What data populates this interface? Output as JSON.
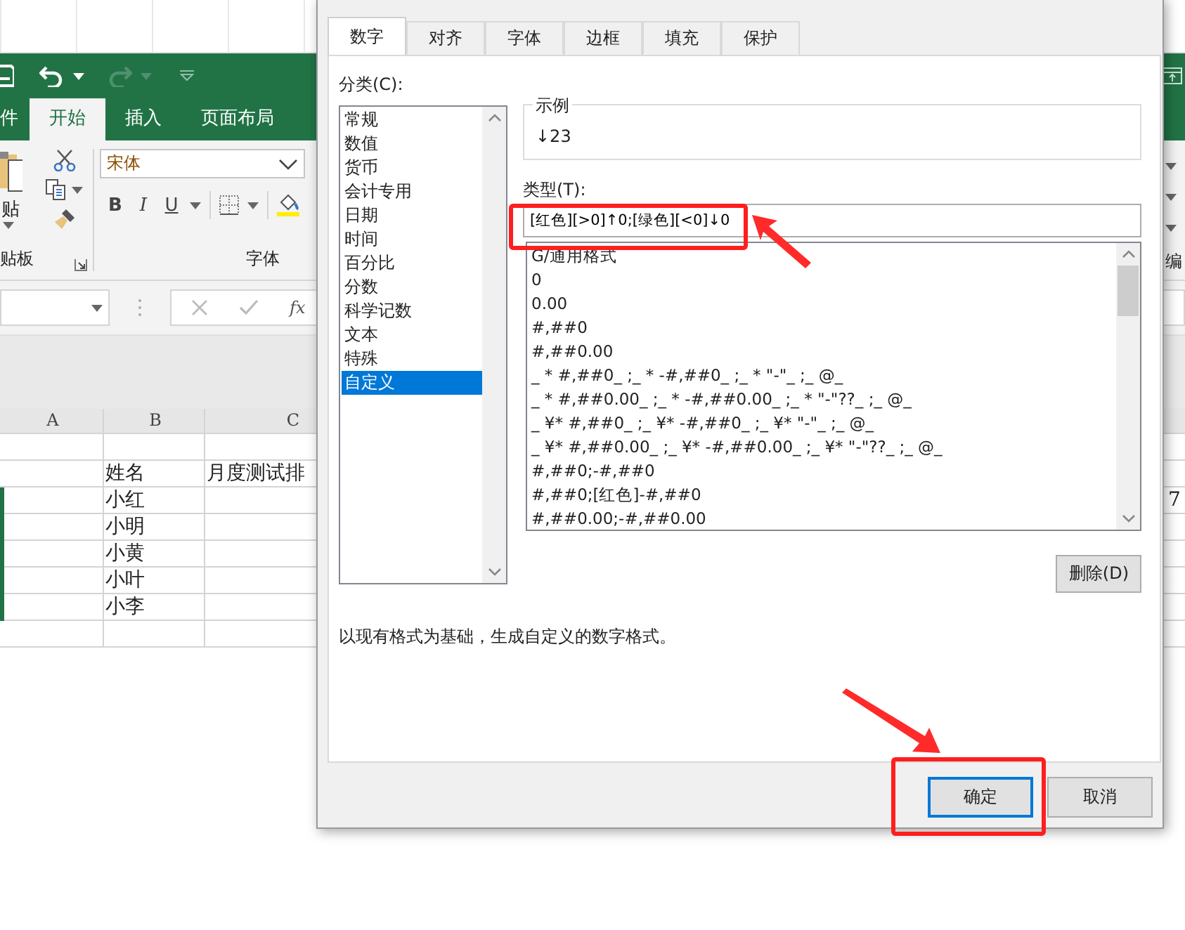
{
  "excel": {
    "ribbon_tabs": [
      {
        "label": "件",
        "selected": false
      },
      {
        "label": "开始",
        "selected": true
      },
      {
        "label": "插入",
        "selected": false
      },
      {
        "label": "页面布局",
        "selected": false
      }
    ],
    "clipboard": {
      "paste_label": "贴",
      "group_label": "贴板"
    },
    "font": {
      "name": "宋体",
      "group_label": "字体",
      "bold": "B",
      "italic": "I",
      "underline": "U"
    },
    "formula_bar": {
      "function_label": "fx"
    },
    "right_group_label": "编",
    "columns": [
      "A",
      "B",
      "C"
    ],
    "rows": [
      [
        "",
        "",
        ""
      ],
      [
        "",
        "姓名",
        "月度测试排"
      ],
      [
        "",
        "小红",
        ""
      ],
      [
        "",
        "小明",
        ""
      ],
      [
        "",
        "小黄",
        ""
      ],
      [
        "",
        "小叶",
        ""
      ],
      [
        "",
        "小李",
        ""
      ],
      [
        "",
        "",
        ""
      ]
    ],
    "right_cell": "7"
  },
  "dialog": {
    "tabs": [
      {
        "label": "数字",
        "selected": true
      },
      {
        "label": "对齐",
        "selected": false
      },
      {
        "label": "字体",
        "selected": false
      },
      {
        "label": "边框",
        "selected": false
      },
      {
        "label": "填充",
        "selected": false
      },
      {
        "label": "保护",
        "selected": false
      }
    ],
    "category_label": "分类(C):",
    "categories": [
      {
        "label": "常规",
        "selected": false
      },
      {
        "label": "数值",
        "selected": false
      },
      {
        "label": "货币",
        "selected": false
      },
      {
        "label": "会计专用",
        "selected": false
      },
      {
        "label": "日期",
        "selected": false
      },
      {
        "label": "时间",
        "selected": false
      },
      {
        "label": "百分比",
        "selected": false
      },
      {
        "label": "分数",
        "selected": false
      },
      {
        "label": "科学记数",
        "selected": false
      },
      {
        "label": "文本",
        "selected": false
      },
      {
        "label": "特殊",
        "selected": false
      },
      {
        "label": "自定义",
        "selected": true
      }
    ],
    "sample_label": "示例",
    "sample_value": "↓23",
    "type_label": "类型(T):",
    "type_value": "[红色][>0]↑0;[绿色][<0]↓0",
    "formats": [
      "G/通用格式",
      "0",
      "0.00",
      "#,##0",
      "#,##0.00",
      "_ * #,##0_ ;_ * -#,##0_ ;_ * \"-\"_ ;_ @_",
      "_ * #,##0.00_ ;_ * -#,##0.00_ ;_ * \"-\"??_ ;_ @_",
      "_ ¥* #,##0_ ;_ ¥* -#,##0_ ;_ ¥* \"-\"_ ;_ @_",
      "_ ¥* #,##0.00_ ;_ ¥* -#,##0.00_ ;_ ¥* \"-\"??_ ;_ @_",
      "#,##0;-#,##0",
      "#,##0;[红色]-#,##0",
      "#,##0.00;-#,##0.00"
    ],
    "delete_button": "删除(D)",
    "description": "以现有格式为基础，生成自定义的数字格式。",
    "buttons": [
      {
        "label": "确定",
        "focused": true
      },
      {
        "label": "取消",
        "focused": false
      }
    ]
  }
}
